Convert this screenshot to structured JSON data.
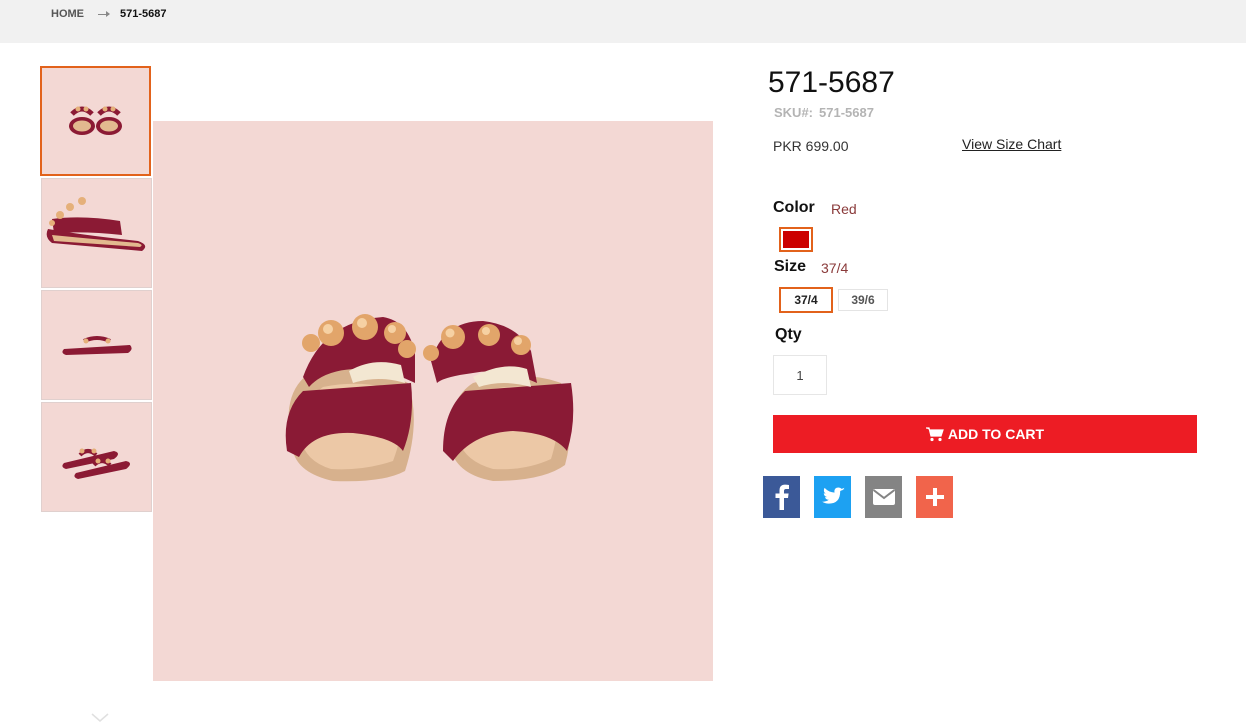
{
  "breadcrumb": {
    "home": "HOME",
    "current": "571-5687"
  },
  "product": {
    "title": "571-5687",
    "sku_label": "SKU#:",
    "sku_value": "571-5687",
    "price": "PKR 699.00",
    "size_chart_link": "View Size Chart"
  },
  "options": {
    "color_label": "Color",
    "color_value": "Red",
    "color_swatch": "#cc0000",
    "size_label": "Size",
    "size_value": "37/4",
    "sizes": [
      "37/4",
      "39/6"
    ],
    "qty_label": "Qty",
    "qty_value": "1"
  },
  "cart": {
    "add_label": "ADD TO CART",
    "icon": "cart-icon"
  },
  "share": [
    {
      "name": "facebook-icon",
      "color": "#3b5998"
    },
    {
      "name": "twitter-icon",
      "color": "#1da1f2"
    },
    {
      "name": "email-icon",
      "color": "#848484"
    },
    {
      "name": "plus-icon",
      "color": "#f1644b"
    }
  ],
  "colors": {
    "accent": "#e2621b",
    "cart_button": "#ed1c24",
    "image_bg": "#f3d8d4"
  }
}
